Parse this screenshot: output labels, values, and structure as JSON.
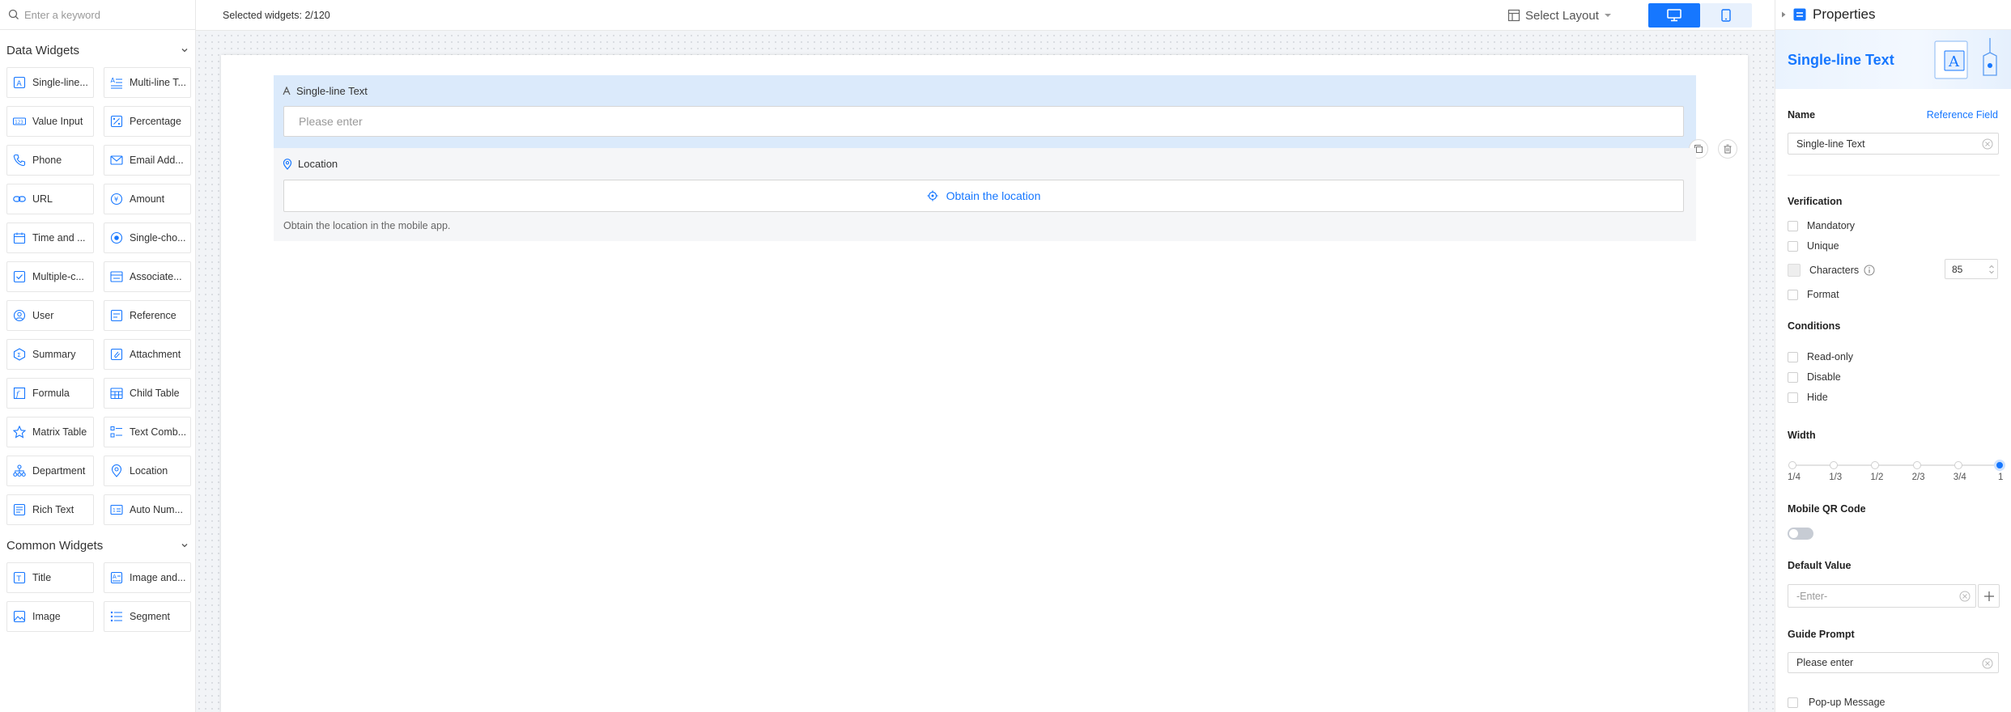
{
  "sidebar": {
    "search_placeholder": "Enter a keyword",
    "data_widgets_title": "Data Widgets",
    "common_widgets_title": "Common Widgets",
    "data_widgets": [
      {
        "label": "Single-line...",
        "icon": "single-line-text-icon"
      },
      {
        "label": "Multi-line T...",
        "icon": "multi-line-text-icon"
      },
      {
        "label": "Value Input",
        "icon": "value-input-icon"
      },
      {
        "label": "Percentage",
        "icon": "percentage-icon"
      },
      {
        "label": "Phone",
        "icon": "phone-icon"
      },
      {
        "label": "Email Add...",
        "icon": "email-icon"
      },
      {
        "label": "URL",
        "icon": "link-icon"
      },
      {
        "label": "Amount",
        "icon": "amount-icon"
      },
      {
        "label": "Time and ...",
        "icon": "calendar-icon"
      },
      {
        "label": "Single-cho...",
        "icon": "radio-icon"
      },
      {
        "label": "Multiple-c...",
        "icon": "checkbox-icon"
      },
      {
        "label": "Associate...",
        "icon": "associate-icon"
      },
      {
        "label": "User",
        "icon": "user-icon"
      },
      {
        "label": "Reference",
        "icon": "reference-icon"
      },
      {
        "label": "Summary",
        "icon": "summary-icon"
      },
      {
        "label": "Attachment",
        "icon": "attachment-icon"
      },
      {
        "label": "Formula",
        "icon": "formula-icon"
      },
      {
        "label": "Child Table",
        "icon": "child-table-icon"
      },
      {
        "label": "Matrix Table",
        "icon": "star-icon"
      },
      {
        "label": "Text Comb...",
        "icon": "text-combination-icon"
      },
      {
        "label": "Department",
        "icon": "department-icon"
      },
      {
        "label": "Location",
        "icon": "location-icon"
      },
      {
        "label": "Rich Text",
        "icon": "rich-text-icon"
      },
      {
        "label": "Auto Num...",
        "icon": "auto-number-icon"
      }
    ],
    "common_widgets": [
      {
        "label": "Title",
        "icon": "title-icon"
      },
      {
        "label": "Image and...",
        "icon": "image-text-icon"
      },
      {
        "label": "Image",
        "icon": "image-icon"
      },
      {
        "label": "Segment",
        "icon": "segment-icon"
      }
    ]
  },
  "toolbar": {
    "selected_widgets": "Selected widgets: 2/120",
    "select_layout": "Select Layout"
  },
  "form": {
    "text_field_label": "Single-line Text",
    "text_field_placeholder": "Please enter",
    "location_label": "Location",
    "location_button": "Obtain the location",
    "location_hint": "Obtain the location in the mobile app."
  },
  "properties": {
    "panel_title": "Properties",
    "widget_title": "Single-line Text",
    "name_label": "Name",
    "reference_field": "Reference Field",
    "name_value": "Single-line Text",
    "verification_title": "Verification",
    "mandatory": "Mandatory",
    "unique": "Unique",
    "characters": "Characters",
    "characters_value": "85",
    "format": "Format",
    "conditions_title": "Conditions",
    "read_only": "Read-only",
    "disable": "Disable",
    "hide": "Hide",
    "width_title": "Width",
    "width_options": [
      "1/4",
      "1/3",
      "1/2",
      "2/3",
      "3/4",
      "1"
    ],
    "width_selected": "1",
    "mobile_qr_title": "Mobile QR Code",
    "mobile_qr_enabled": false,
    "default_value_title": "Default Value",
    "default_value_placeholder": "-Enter-",
    "guide_prompt_title": "Guide Prompt",
    "guide_prompt_value": "Please enter",
    "popup_message": "Pop-up Message"
  },
  "colors": {
    "accent": "#1677ff",
    "selected_field_bg": "#dbeafb"
  }
}
